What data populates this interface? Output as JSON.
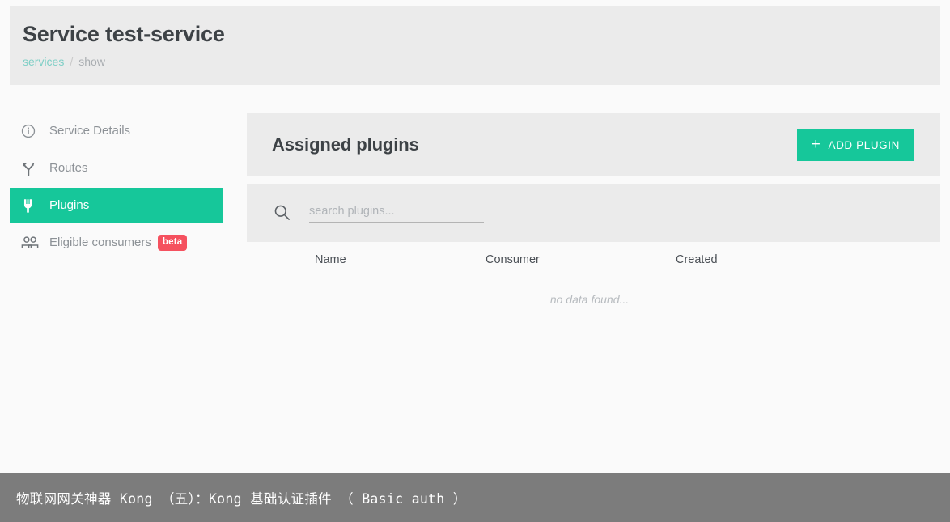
{
  "header": {
    "title": "Service test-service",
    "breadcrumb": {
      "link": "services",
      "separator": "/",
      "current": "show"
    }
  },
  "sidebar": {
    "items": [
      {
        "label": "Service Details",
        "icon": "info-circle-icon",
        "active": false
      },
      {
        "label": "Routes",
        "icon": "route-branch-icon",
        "active": false
      },
      {
        "label": "Plugins",
        "icon": "plug-icon",
        "active": true
      },
      {
        "label": "Eligible consumers",
        "icon": "people-icon",
        "active": false,
        "badge": "beta"
      }
    ]
  },
  "main": {
    "card_title": "Assigned plugins",
    "add_button": {
      "label": "ADD PLUGIN",
      "plus": "+"
    },
    "search": {
      "placeholder": "search plugins...",
      "value": "",
      "icon": "search-icon"
    },
    "table": {
      "columns": [
        "Name",
        "Consumer",
        "Created"
      ],
      "rows": [],
      "empty_text": "no data found..."
    }
  },
  "footer": {
    "text": "物联网网关神器 Kong （五）：Kong 基础认证插件 （ Basic auth ）"
  },
  "colors": {
    "accent_green": "#16c79a",
    "badge_red": "#f5515f",
    "link_teal": "#7fcfc6",
    "band_gray": "#ebebeb",
    "page_bg": "#fafafa",
    "footer_gray": "#7c7c7c"
  }
}
